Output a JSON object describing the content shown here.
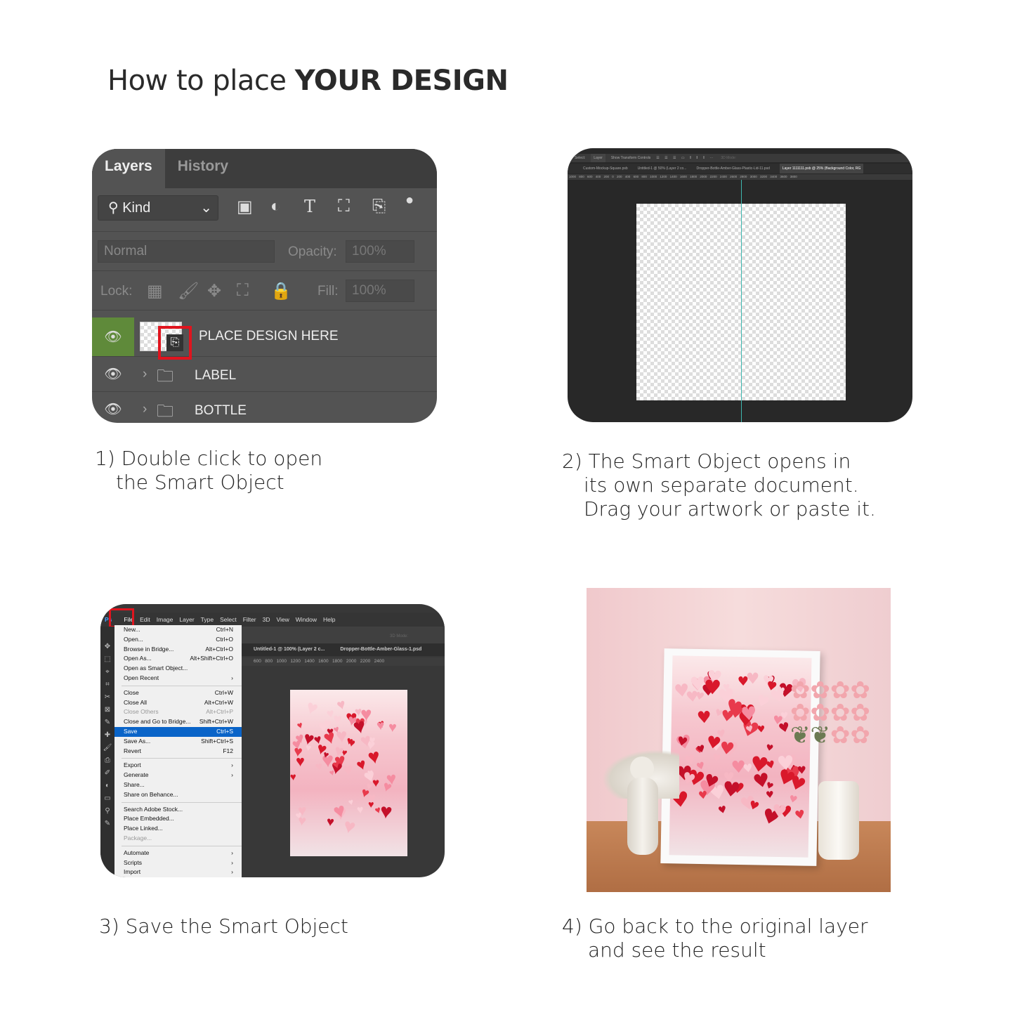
{
  "title": {
    "part1": "How to place ",
    "part2": "YOUR DESIGN"
  },
  "colors": {
    "highlight_red": "#e0141e",
    "layer_active_green": "#5f8a3a",
    "menu_selected": "#0a64c8"
  },
  "step1": {
    "caption": [
      "1) Double click to open",
      "the Smart Object"
    ],
    "tabs": [
      "Layers",
      "History"
    ],
    "filter": "Kind",
    "blend_mode": "Normal",
    "opacity_label": "Opacity:",
    "opacity_value": "100%",
    "lock_label": "Lock:",
    "fill_label": "Fill:",
    "fill_value": "100%",
    "layers": [
      {
        "name": "PLACE DESIGN HERE",
        "type": "smart-object",
        "selected": true
      },
      {
        "name": "LABEL",
        "type": "group"
      },
      {
        "name": "BOTTLE",
        "type": "group"
      }
    ]
  },
  "step2": {
    "caption": [
      "2) The Smart Object opens in",
      "its own separate document.",
      "Drag your artwork or paste it."
    ],
    "options_bar": [
      "Select:",
      "Layer",
      "Show Transform Controls",
      "3D Mode:"
    ],
    "doc_tabs": [
      "Custom-Mockup-Square.psb",
      "Untitled-1 @ 50% (Layer 2 co...",
      "Dropper-Bottle-Amber-Glass-Plastic-Lid-11.psd",
      "Layer 1111111.psb @ 25% (Background Color, RG"
    ],
    "ruler": "1000  800  600  400  200  0  200  400  600  800  1000  1200  1400  1600  1800  2000  2200  2400  2600  2800  3000  3200  3400  3600  3800"
  },
  "step3": {
    "caption": [
      "3) Save the Smart Object"
    ],
    "menubar": [
      "File",
      "Edit",
      "Image",
      "Layer",
      "Type",
      "Select",
      "Filter",
      "3D",
      "View",
      "Window",
      "Help"
    ],
    "doc_tabs": [
      "Untitled-1 @ 100% (Layer 2 c...",
      "Dropper-Bottle-Amber-Glass-1.psd"
    ],
    "ruler": "600   800   1000   1200   1400   1600   1800   2000   2200   2400",
    "mode_label": "3D Mode:",
    "menu": [
      [
        {
          "l": "New...",
          "s": "Ctrl+N"
        },
        {
          "l": "Open...",
          "s": "Ctrl+O"
        },
        {
          "l": "Browse in Bridge...",
          "s": "Alt+Ctrl+O"
        },
        {
          "l": "Open As...",
          "s": "Alt+Shift+Ctrl+O"
        },
        {
          "l": "Open as Smart Object...",
          "s": ""
        },
        {
          "l": "Open Recent",
          "s": "›"
        }
      ],
      [
        {
          "l": "Close",
          "s": "Ctrl+W"
        },
        {
          "l": "Close All",
          "s": "Alt+Ctrl+W"
        },
        {
          "l": "Close Others",
          "s": "Alt+Ctrl+P",
          "disabled": true
        },
        {
          "l": "Close and Go to Bridge...",
          "s": "Shift+Ctrl+W"
        },
        {
          "l": "Save",
          "s": "Ctrl+S",
          "selected": true
        },
        {
          "l": "Save As...",
          "s": "Shift+Ctrl+S"
        },
        {
          "l": "Revert",
          "s": "F12"
        }
      ],
      [
        {
          "l": "Export",
          "s": "›"
        },
        {
          "l": "Generate",
          "s": "›"
        },
        {
          "l": "Share...",
          "s": ""
        },
        {
          "l": "Share on Behance...",
          "s": ""
        }
      ],
      [
        {
          "l": "Search Adobe Stock...",
          "s": ""
        },
        {
          "l": "Place Embedded...",
          "s": ""
        },
        {
          "l": "Place Linked...",
          "s": ""
        },
        {
          "l": "Package...",
          "s": "",
          "disabled": true
        }
      ],
      [
        {
          "l": "Automate",
          "s": "›"
        },
        {
          "l": "Scripts",
          "s": "›"
        },
        {
          "l": "Import",
          "s": "›"
        }
      ]
    ]
  },
  "step4": {
    "caption": [
      "4) Go back to the original layer",
      "and see the result"
    ]
  }
}
